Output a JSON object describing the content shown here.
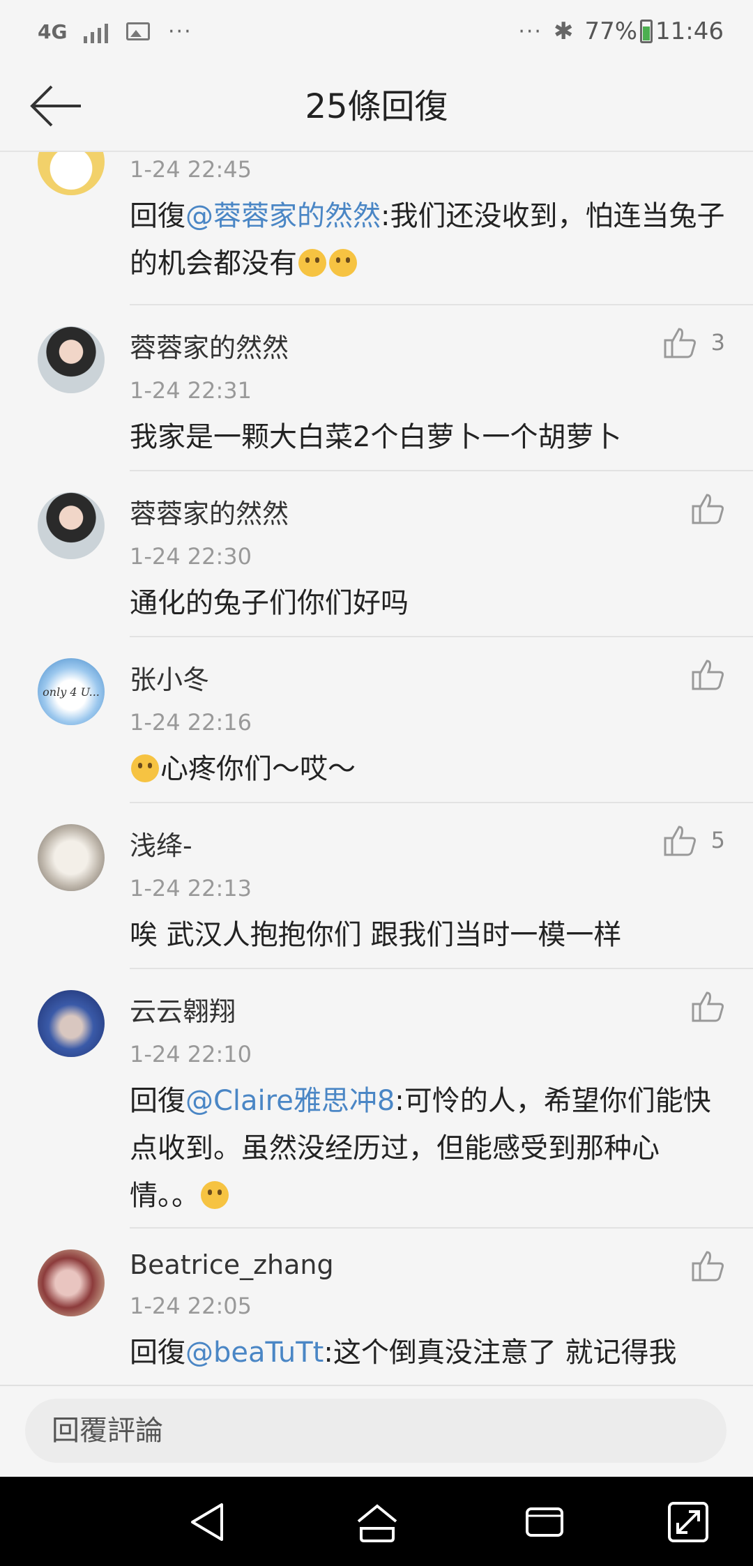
{
  "status_bar": {
    "network": "4G",
    "more": "···",
    "more_right": "···",
    "battery": "77%",
    "time": "11:46"
  },
  "header": {
    "title": "25條回復"
  },
  "comments": [
    {
      "name": "",
      "time": "1-24 22:45",
      "prefix": "回復",
      "mention": "@蓉蓉家的然然",
      "body": ":我们还没收到，怕连当兔子的机会都没有",
      "likes": ""
    },
    {
      "name": "蓉蓉家的然然",
      "time": "1-24 22:31",
      "prefix": "",
      "mention": "",
      "body": "我家是一颗大白菜2个白萝卜一个胡萝卜",
      "likes": "3"
    },
    {
      "name": "蓉蓉家的然然",
      "time": "1-24 22:30",
      "prefix": "",
      "mention": "",
      "body": "通化的兔子们你们好吗",
      "likes": ""
    },
    {
      "name": "张小冬",
      "time": "1-24 22:16",
      "prefix": "",
      "mention": "",
      "body": "心疼你们～哎～",
      "likes": "",
      "avatar_text": "only 4 U..."
    },
    {
      "name": "浅绛-",
      "time": "1-24 22:13",
      "prefix": "",
      "mention": "",
      "body": "唉 武汉人抱抱你们 跟我们当时一模一样",
      "likes": "5"
    },
    {
      "name": "云云翱翔",
      "time": "1-24 22:10",
      "prefix": "回復",
      "mention": "@Claire雅思冲8",
      "body": ":可怜的人，希望你们能快点收到。虽然没经历过，但能感受到那种心情。。",
      "likes": ""
    },
    {
      "name": "Beatrice_zhang",
      "time": "1-24 22:05",
      "prefix": "回復",
      "mention": "@beaTuTt",
      "body": ":这个倒真没注意了 就记得我",
      "likes": ""
    }
  ],
  "reply_input": {
    "placeholder": "回覆評論"
  },
  "colors": {
    "mention": "#4a86c5",
    "background": "#f5f5f5",
    "battery": "#4caf50"
  }
}
